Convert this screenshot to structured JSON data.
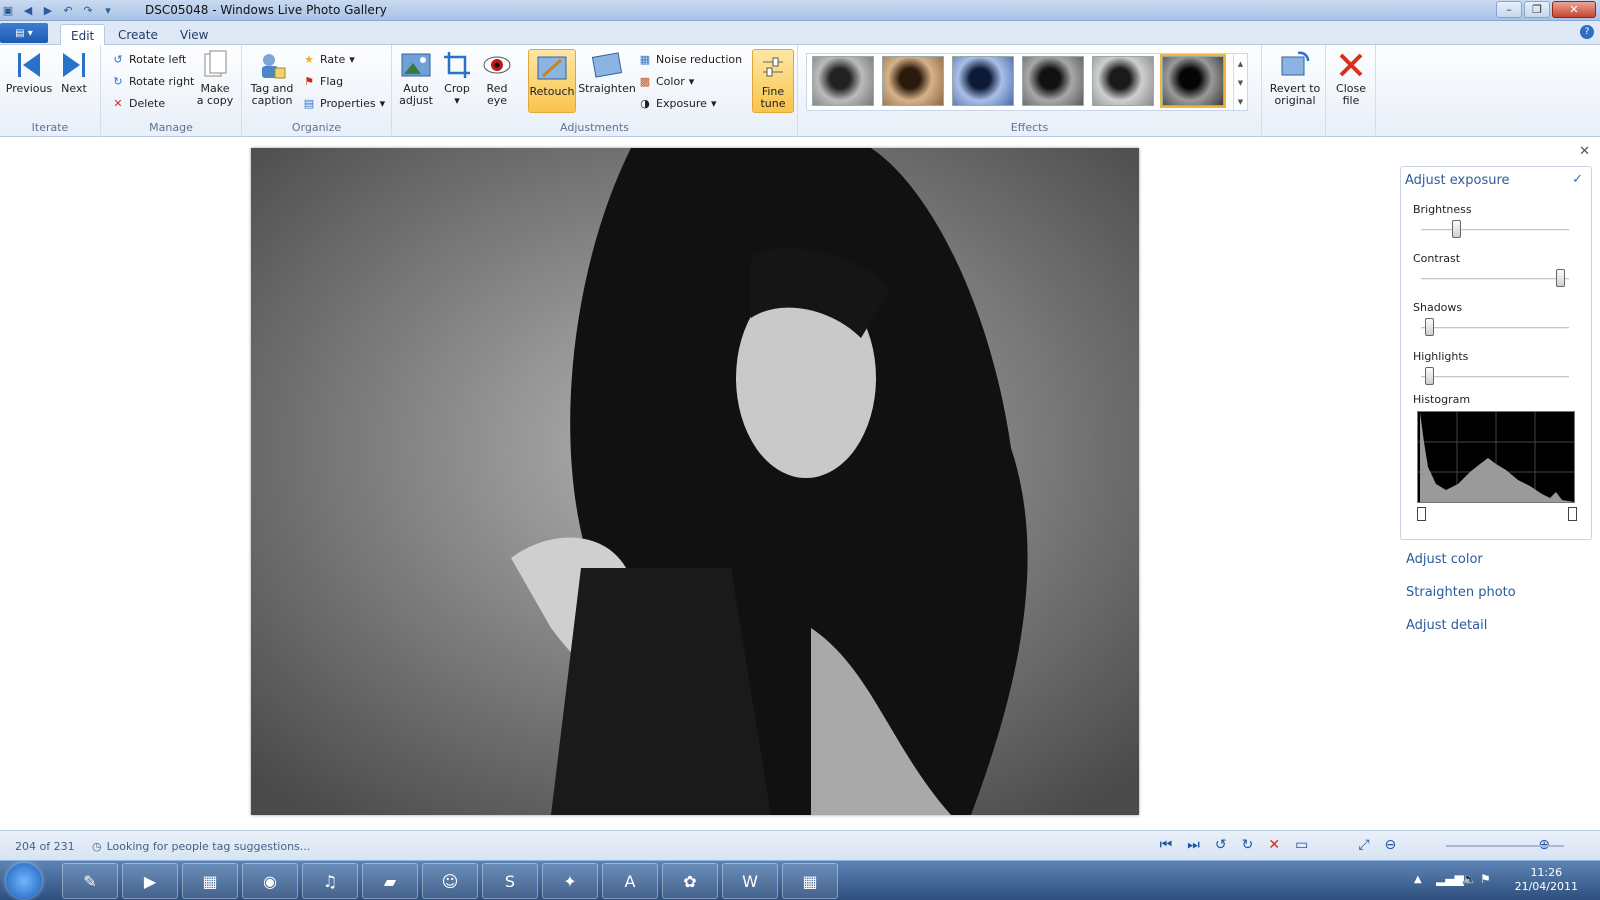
{
  "window": {
    "title": "DSC05048 - Windows Live Photo Gallery"
  },
  "tabs": [
    {
      "label": "Edit"
    },
    {
      "label": "Create"
    },
    {
      "label": "View"
    }
  ],
  "ribbon": {
    "iterate": {
      "label": "Iterate",
      "previous": "Previous",
      "next": "Next"
    },
    "manage": {
      "label": "Manage",
      "rotate_left": "Rotate left",
      "rotate_right": "Rotate right",
      "delete": "Delete",
      "make_copy_1": "Make",
      "make_copy_2": "a copy"
    },
    "organize": {
      "label": "Organize",
      "tag_1": "Tag and",
      "tag_2": "caption",
      "rate": "Rate",
      "flag": "Flag",
      "properties": "Properties"
    },
    "adjustments": {
      "label": "Adjustments",
      "auto_1": "Auto",
      "auto_2": "adjust",
      "crop": "Crop",
      "redeye_1": "Red",
      "redeye_2": "eye",
      "retouch": "Retouch",
      "straighten": "Straighten",
      "noise": "Noise reduction",
      "color": "Color",
      "exposure": "Exposure",
      "fine_1": "Fine",
      "fine_2": "tune"
    },
    "effects": {
      "label": "Effects"
    },
    "revert": {
      "line1": "Revert to",
      "line2": "original"
    },
    "close": {
      "line1": "Close",
      "line2": "file"
    }
  },
  "panel": {
    "exposure_title": "Adjust exposure",
    "brightness": "Brightness",
    "contrast": "Contrast",
    "shadows": "Shadows",
    "highlights": "Highlights",
    "histogram": "Histogram",
    "adjust_color": "Adjust color",
    "straighten_photo": "Straighten photo",
    "adjust_detail": "Adjust detail",
    "levels": {
      "brightness": 0.22,
      "contrast": 0.97,
      "shadows": 0.03,
      "highlights": 0.03
    }
  },
  "status": {
    "count": "204 of 231",
    "message": "Looking for people tag suggestions..."
  },
  "tray": {
    "time": "11:26",
    "date": "21/04/2011"
  }
}
